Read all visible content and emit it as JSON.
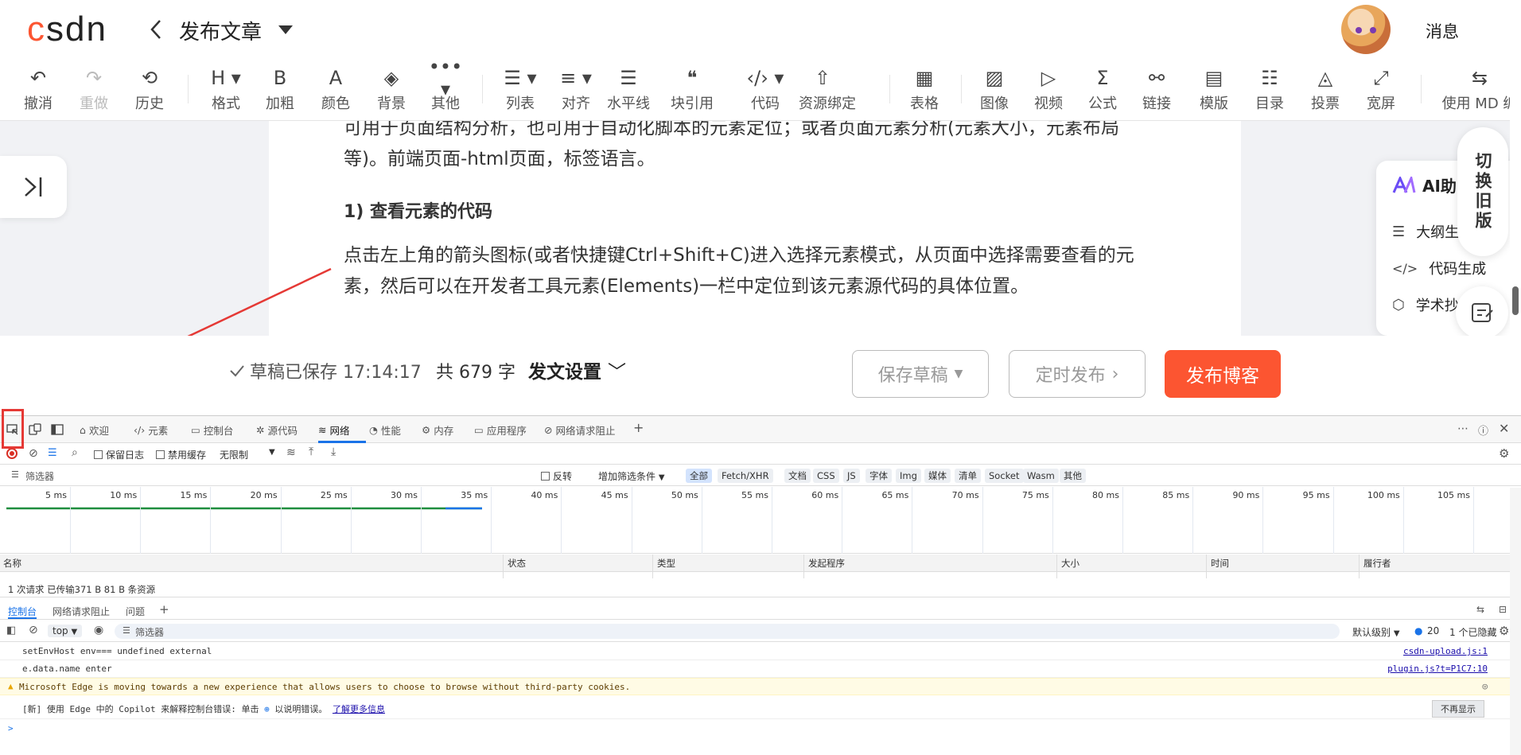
{
  "header": {
    "logo": "CSDN",
    "title": "发布文章",
    "messages": "消息"
  },
  "toolbar": {
    "items": [
      {
        "label": "撤消",
        "icon": "undo-icon"
      },
      {
        "label": "重做",
        "icon": "redo-icon"
      },
      {
        "label": "历史",
        "icon": "history-icon"
      },
      {
        "label": "格式",
        "icon": "heading-icon"
      },
      {
        "label": "加粗",
        "icon": "bold-icon"
      },
      {
        "label": "颜色",
        "icon": "text-color-icon"
      },
      {
        "label": "背景",
        "icon": "paint-bucket-icon"
      },
      {
        "label": "其他",
        "icon": "more-icon"
      },
      {
        "label": "列表",
        "icon": "list-icon"
      },
      {
        "label": "对齐",
        "icon": "align-icon"
      },
      {
        "label": "水平线",
        "icon": "horizontal-rule-icon"
      },
      {
        "label": "块引用",
        "icon": "quote-icon"
      },
      {
        "label": "代码",
        "icon": "code-icon"
      },
      {
        "label": "资源绑定",
        "icon": "resource-icon"
      },
      {
        "label": "表格",
        "icon": "table-icon"
      },
      {
        "label": "图像",
        "icon": "image-icon"
      },
      {
        "label": "视频",
        "icon": "video-icon"
      },
      {
        "label": "公式",
        "icon": "sigma-icon"
      },
      {
        "label": "链接",
        "icon": "link-icon"
      },
      {
        "label": "模版",
        "icon": "template-icon"
      },
      {
        "label": "目录",
        "icon": "toc-icon"
      },
      {
        "label": "投票",
        "icon": "vote-icon"
      },
      {
        "label": "宽屏",
        "icon": "widescreen-icon"
      },
      {
        "label": "使用 MD 编",
        "icon": "switch-md-icon"
      }
    ]
  },
  "editor": {
    "intro": "可用于页面结构分析，也可用于自动化脚本的元素定位；或者页面元素分析(元素大小，元素布局等)。前端页面-html页面，标签语言。",
    "heading": "1) 查看元素的代码",
    "body": "点击左上角的箭头图标(或者快捷键Ctrl+Shift+C)进入选择元素模式，从页面中选择需要查看的元素，然后可以在开发者工具元素(Elements)一栏中定位到该元素源代码的具体位置。"
  },
  "ai_panel": {
    "title": "AI助",
    "items": [
      "大纲生",
      "代码生成",
      "学术抄"
    ],
    "switch_old": "切换旧版"
  },
  "footer": {
    "save_status": "草稿已保存 17:14:17",
    "word_count": "共 679 字",
    "post_settings": "发文设置",
    "save_draft": "保存草稿",
    "schedule": "定时发布",
    "publish": "发布博客"
  },
  "devtools": {
    "tabs": [
      "欢迎",
      "元素",
      "控制台",
      "源代码",
      "网络",
      "性能",
      "内存",
      "应用程序",
      "网络请求阻止"
    ],
    "active_tab": "网络",
    "net_toolbar": {
      "preserve_log": "保留日志",
      "disable_cache": "禁用缓存",
      "throttle": "无限制"
    },
    "filter": {
      "placeholder": "筛选器",
      "invert": "反转",
      "more_filters": "增加筛选条件",
      "types": [
        "全部",
        "Fetch/XHR",
        "文档",
        "CSS",
        "JS",
        "字体",
        "Img",
        "媒体",
        "清单",
        "Socket",
        "Wasm",
        "其他"
      ]
    },
    "timeline_ticks": [
      "5 ms",
      "10 ms",
      "15 ms",
      "20 ms",
      "25 ms",
      "30 ms",
      "35 ms",
      "40 ms",
      "45 ms",
      "50 ms",
      "55 ms",
      "60 ms",
      "65 ms",
      "70 ms",
      "75 ms",
      "80 ms",
      "85 ms",
      "90 ms",
      "95 ms",
      "100 ms",
      "105 ms"
    ],
    "columns": [
      "名称",
      "状态",
      "类型",
      "发起程序",
      "大小",
      "时间",
      "履行者"
    ],
    "summary": "1 次请求  已传输371 B  81 B 条资源",
    "drawer_tabs": [
      "控制台",
      "网络请求阻止",
      "问题"
    ],
    "console_toolbar": {
      "context": "top",
      "filter": "筛选器",
      "level": "默认级别",
      "count": "20",
      "hidden": "1 个已隐藏"
    },
    "console_lines": [
      {
        "text": "setEnvHost env=== undefined external",
        "source": "csdn-upload.js:1"
      },
      {
        "text": "e.data.name enter",
        "source": "plugin.js?t=P1C7:10"
      },
      {
        "text": "Microsoft Edge is moving towards a new experience that allows users to choose to browse without third-party cookies.",
        "source": ""
      }
    ],
    "copilot_line": {
      "prefix": "[新] 使用 Edge 中的 Copilot 来解释控制台错误: 单击",
      "middle": "以说明错误。",
      "link": "了解更多信息",
      "dismiss": "不再显示"
    },
    "prompt": ">"
  }
}
